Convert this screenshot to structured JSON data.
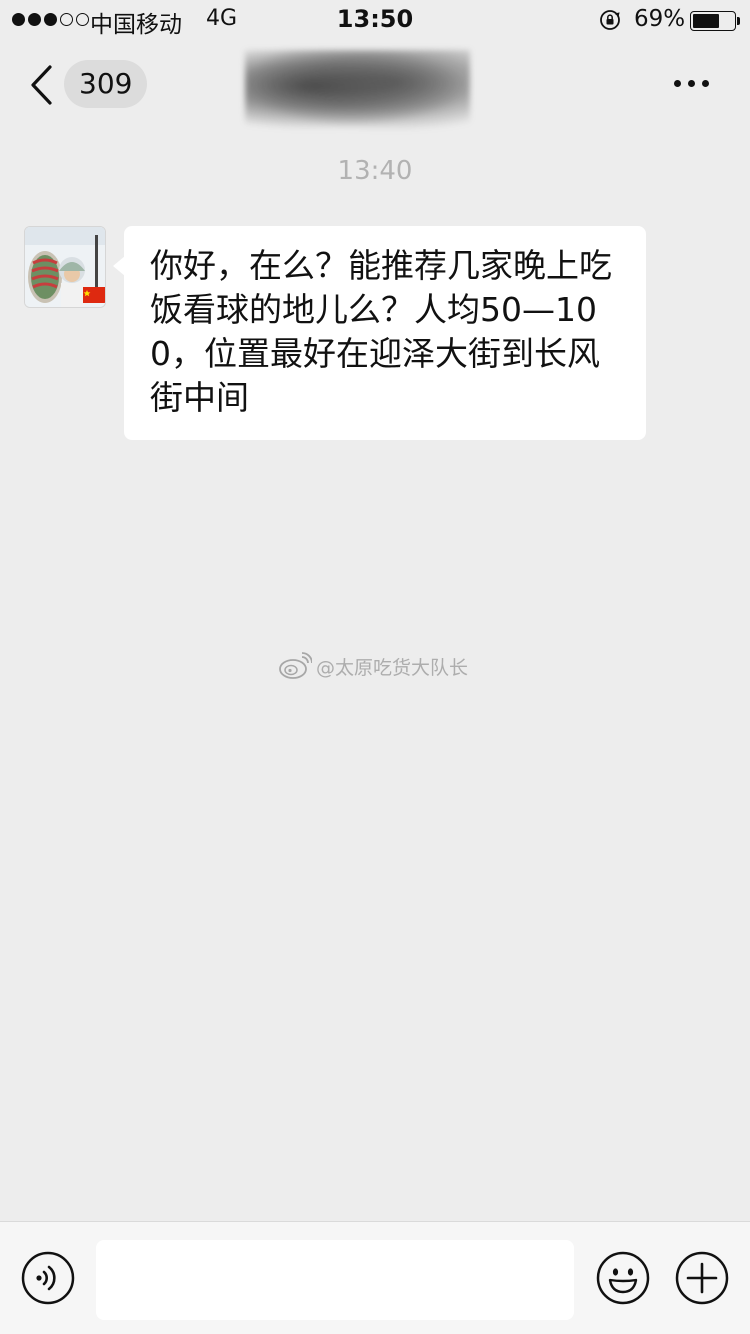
{
  "status_bar": {
    "carrier": "中国移动",
    "network": "4G",
    "time": "13:50",
    "battery_percent": "69%",
    "battery_level": 0.69,
    "signal_bars_filled": 3,
    "signal_bars_total": 5
  },
  "nav": {
    "unread_count": "309",
    "title": ""
  },
  "chat": {
    "timestamp": "13:40",
    "messages": [
      {
        "sender": "other",
        "text": "你好，在么？能推荐几家晚上吃饭看球的地儿么？人均50—100，位置最好在迎泽大街到长风街中间"
      }
    ]
  },
  "watermark": {
    "text": "@太原吃货大队长"
  },
  "input_bar": {
    "value": "",
    "placeholder": ""
  },
  "icons": {
    "back": "back-chevron-icon",
    "more": "more-dots-icon",
    "voice": "voice-icon",
    "emoji": "emoji-icon",
    "add": "plus-icon",
    "lock": "rotation-lock-icon",
    "weibo": "weibo-icon"
  },
  "colors": {
    "background": "#ededed",
    "bubble": "#ffffff",
    "timestamp": "#b2b2b2",
    "input_bar": "#f6f6f6"
  }
}
